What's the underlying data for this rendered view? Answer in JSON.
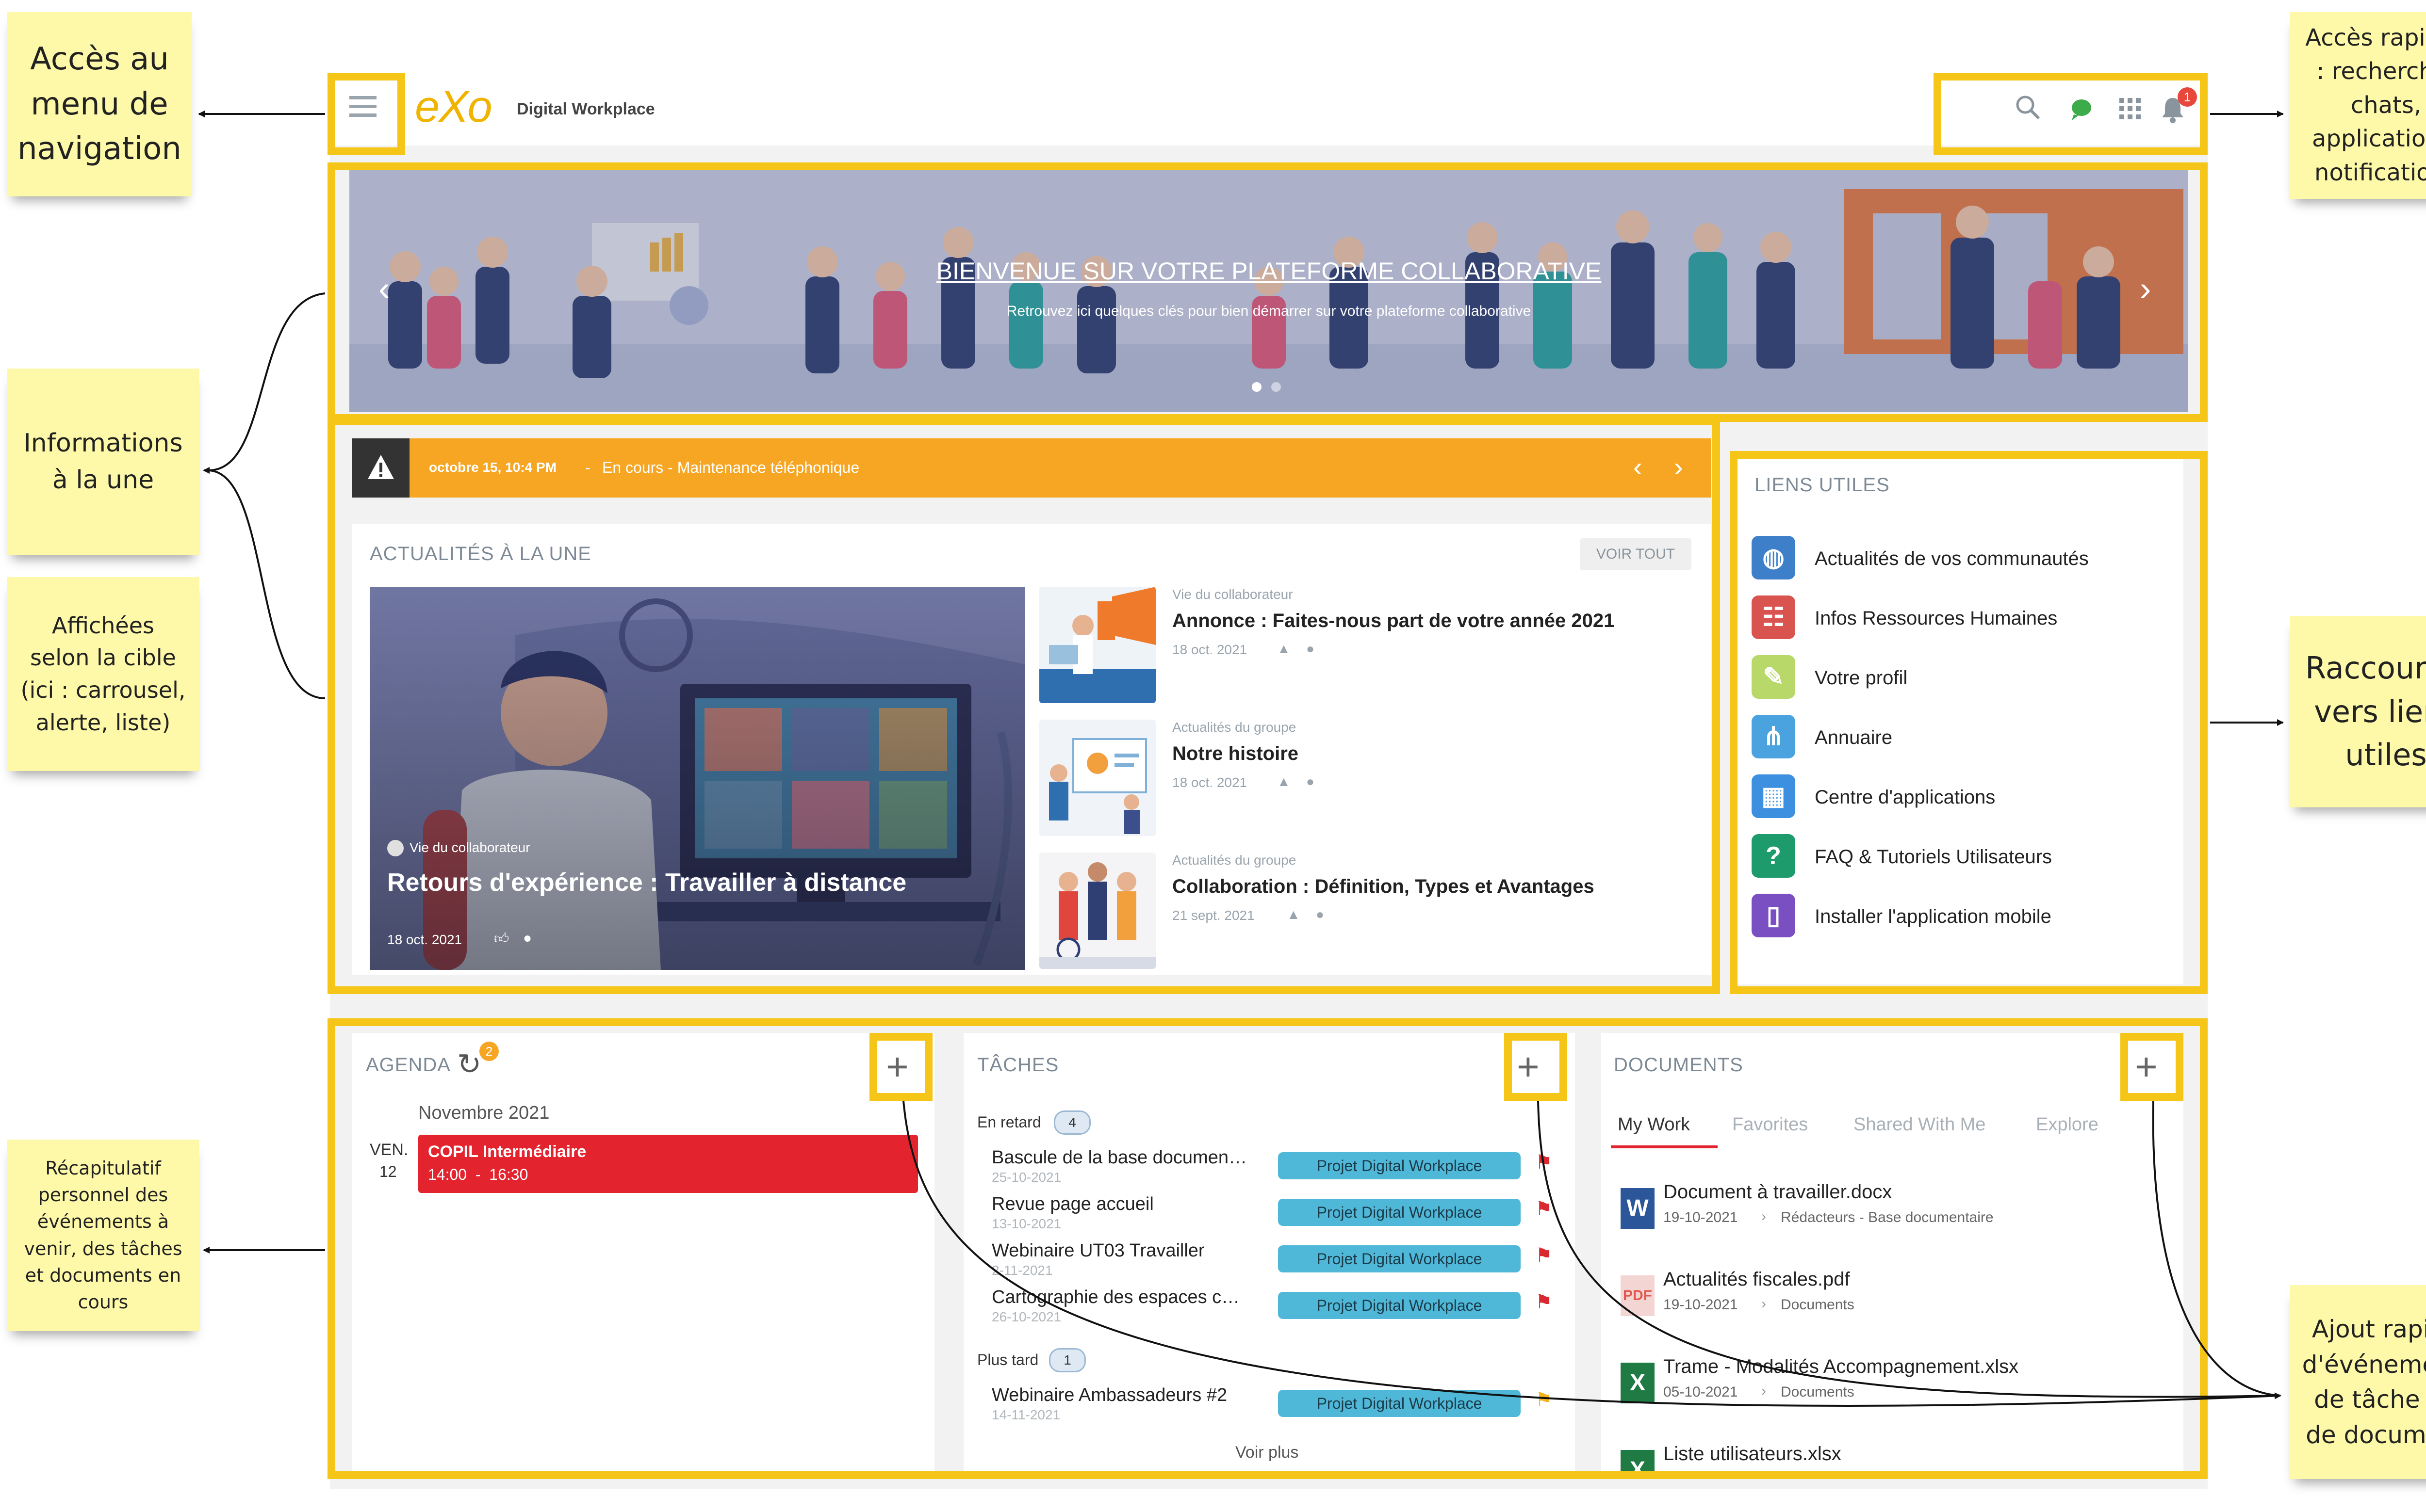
{
  "annotations": {
    "nav_menu": "Accès au menu de navigation",
    "quick_access": "Accès rapides : recherche, chats, applications, notifications",
    "featured_info": "Informations à la une",
    "targeted": "Affichées selon la cible (ici : carrousel, alerte, liste)",
    "useful_links_shortcuts": "Raccourcis vers liens utiles",
    "personal_summary": "Récapitulatif personnel des événements à venir, des tâches et documents en cours",
    "quick_add": "Ajout rapide d'événement, de tâche ou de document"
  },
  "header": {
    "logo": "eXo",
    "app_name": "Digital Workplace",
    "notification_count": "1",
    "icons": [
      "menu-icon",
      "search-icon",
      "chat-icon",
      "apps-grid-icon",
      "bell-icon"
    ]
  },
  "banner": {
    "title": "BIENVENUE SUR VOTRE PLATEFORME COLLABORATIVE",
    "subtitle": "Retrouvez ici quelques clés pour bien démarrer sur votre plateforme collaborative"
  },
  "alert": {
    "date": "octobre 15, 10:4 PM",
    "separator": "-",
    "message": "En cours - Maintenance téléphonique"
  },
  "news": {
    "heading": "ACTUALITÉS À LA UNE",
    "see_all": "VOIR TOUT",
    "featured": {
      "category": "Vie du collaborateur",
      "title": "Retours d'expérience : Travailler à distance",
      "date": "18 oct. 2021"
    },
    "items": [
      {
        "category": "Vie du collaborateur",
        "title": "Annonce : Faites-nous part de votre année 2021",
        "date": "18 oct. 2021"
      },
      {
        "category": "Actualités du groupe",
        "title": "Notre histoire",
        "date": "18 oct. 2021"
      },
      {
        "category": "Actualités du groupe",
        "title": "Collaboration : Définition, Types et Avantages",
        "date": "21 sept. 2021"
      }
    ]
  },
  "links": {
    "heading": "LIENS UTILES",
    "items": [
      {
        "label": "Actualités de vos communautés",
        "icon": "community-news-icon"
      },
      {
        "label": "Infos Ressources Humaines",
        "icon": "hr-icon"
      },
      {
        "label": "Votre profil",
        "icon": "profile-icon"
      },
      {
        "label": "Annuaire",
        "icon": "directory-icon"
      },
      {
        "label": "Centre d'applications",
        "icon": "app-center-icon"
      },
      {
        "label": "FAQ & Tutoriels Utilisateurs",
        "icon": "faq-icon"
      },
      {
        "label": "Installer l'application mobile",
        "icon": "mobile-app-icon"
      }
    ]
  },
  "agenda": {
    "heading": "AGENDA",
    "badge": "2",
    "month": "Novembre 2021",
    "day_name": "VEN.",
    "day_num": "12",
    "event_title": "COPIL Intermédiaire",
    "event_time": "14:00  -  16:30"
  },
  "tasks": {
    "heading": "TÂCHES",
    "late_label": "En retard",
    "late_count": "4",
    "later_label": "Plus tard",
    "later_count": "1",
    "late": [
      {
        "title": "Bascule de la base documen…",
        "date": "25-10-2021",
        "project": "Projet Digital Workplace"
      },
      {
        "title": "Revue page accueil",
        "date": "13-10-2021",
        "project": "Projet Digital Workplace"
      },
      {
        "title": "Webinaire UT03 Travailler",
        "date": "2-11-2021",
        "project": "Projet Digital Workplace"
      },
      {
        "title": "Cartographie des espaces c…",
        "date": "26-10-2021",
        "project": "Projet Digital Workplace"
      }
    ],
    "later": [
      {
        "title": "Webinaire Ambassadeurs #2",
        "date": "14-11-2021",
        "project": "Projet Digital Workplace"
      }
    ],
    "see_more": "Voir plus"
  },
  "documents": {
    "heading": "DOCUMENTS",
    "tabs": [
      "My Work",
      "Favorites",
      "Shared With Me",
      "Explore"
    ],
    "items": [
      {
        "name": "Document à travailler.docx",
        "date": "19-10-2021",
        "path": "Rédacteurs - Base documentaire",
        "type": "W",
        "color": "#2b579a"
      },
      {
        "name": "Actualités fiscales.pdf",
        "date": "19-10-2021",
        "path": "Documents",
        "type": "PDF",
        "color": "#e05a4f"
      },
      {
        "name": "Trame - Modalités Accompagnement.xlsx",
        "date": "05-10-2021",
        "path": "Documents",
        "type": "X",
        "color": "#1f7a44"
      },
      {
        "name": "Liste utilisateurs.xlsx",
        "date": "",
        "path": "",
        "type": "X",
        "color": "#1f7a44"
      }
    ]
  },
  "colors": {
    "highlight": "#f5c518",
    "alert_bg": "#f6a623",
    "event_red": "#e3232e",
    "tag_blue": "#4fb8d8",
    "sticky": "#fdf9a8"
  }
}
